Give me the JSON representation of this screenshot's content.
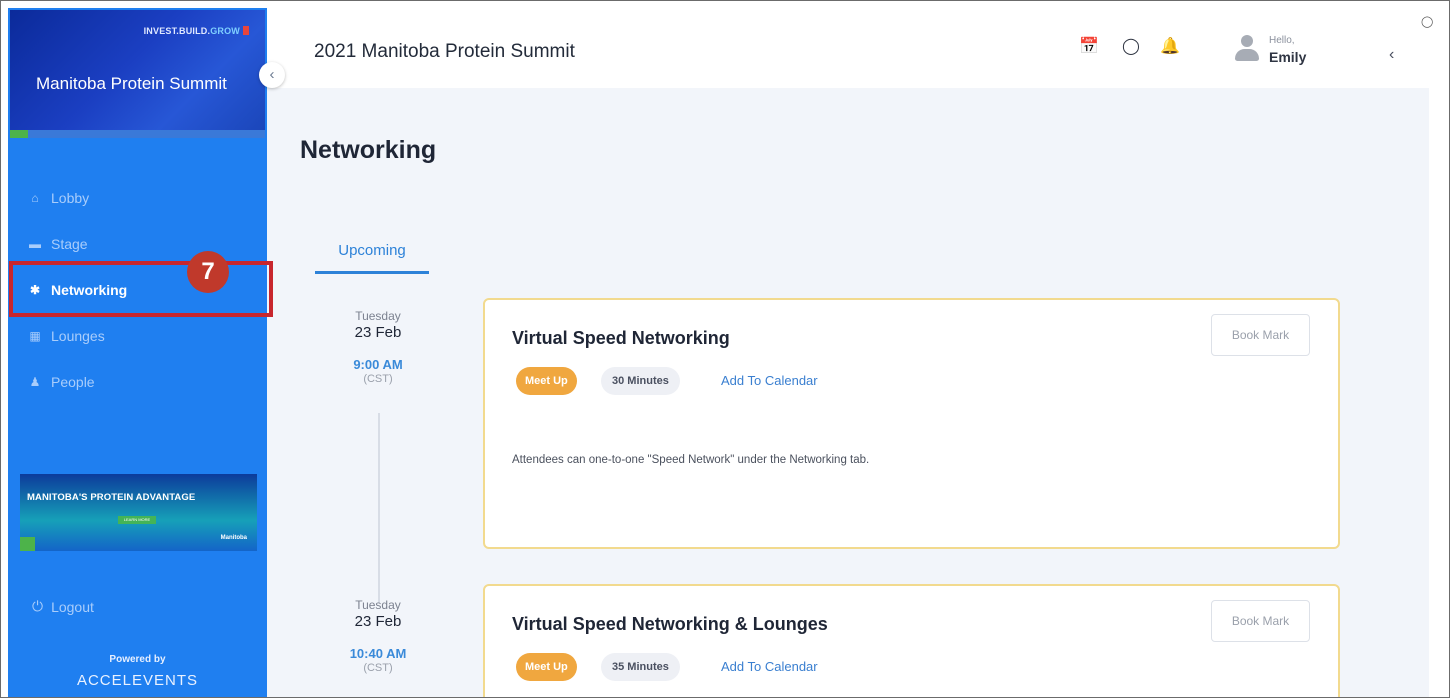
{
  "sidebar": {
    "banner": {
      "tag_left": "INVEST.BUILD.",
      "tag_right": "GROW",
      "title": "Manitoba Protein Summit"
    },
    "collapse_icon": "chevron-left-icon",
    "items": [
      {
        "label": "Lobby",
        "icon": "home-icon"
      },
      {
        "label": "Stage",
        "icon": "stage-icon"
      },
      {
        "label": "Networking",
        "icon": "networking-icon",
        "active": true
      },
      {
        "label": "Lounges",
        "icon": "lounges-icon"
      },
      {
        "label": "People",
        "icon": "people-icon"
      }
    ],
    "ad": {
      "title": "MANITOBA'S PROTEIN ADVANTAGE",
      "button": "LEARN MORE",
      "logo": "Manitoba"
    },
    "logout": "Logout",
    "powered_by": "Powered by",
    "brand": "ACCELEVENTS"
  },
  "annotation": {
    "step_number": "7",
    "highlight_color": "#c8262d"
  },
  "header": {
    "event_title": "2021 Manitoba Protein Summit",
    "icons": [
      "calendar-icon",
      "chat-icon",
      "bell-icon"
    ],
    "user": {
      "greeting": "Hello,",
      "name": "Emily"
    }
  },
  "main": {
    "page_title": "Networking",
    "tabs": [
      {
        "label": "Upcoming",
        "active": true
      }
    ],
    "sessions": [
      {
        "day": "Tuesday",
        "date": "23 Feb",
        "time": "9:00 AM",
        "timezone": "(CST)",
        "title": "Virtual Speed Networking",
        "bookmark": "Book Mark",
        "type_tag": "Meet Up",
        "duration": "30 Minutes",
        "add_calendar": "Add To Calendar",
        "description": "Attendees can one-to-one \"Speed Network\" under the Networking tab."
      },
      {
        "day": "Tuesday",
        "date": "23 Feb",
        "time": "10:40 AM",
        "timezone": "(CST)",
        "title": "Virtual Speed Networking & Lounges",
        "bookmark": "Book Mark",
        "type_tag": "Meet Up",
        "duration": "35 Minutes",
        "add_calendar": "Add To Calendar"
      }
    ]
  },
  "colors": {
    "sidebar_bg": "#1f7ff0",
    "accent_blue": "#2d82d8",
    "meetup_tag": "#f0a73f",
    "card_border": "#f2da8e"
  }
}
